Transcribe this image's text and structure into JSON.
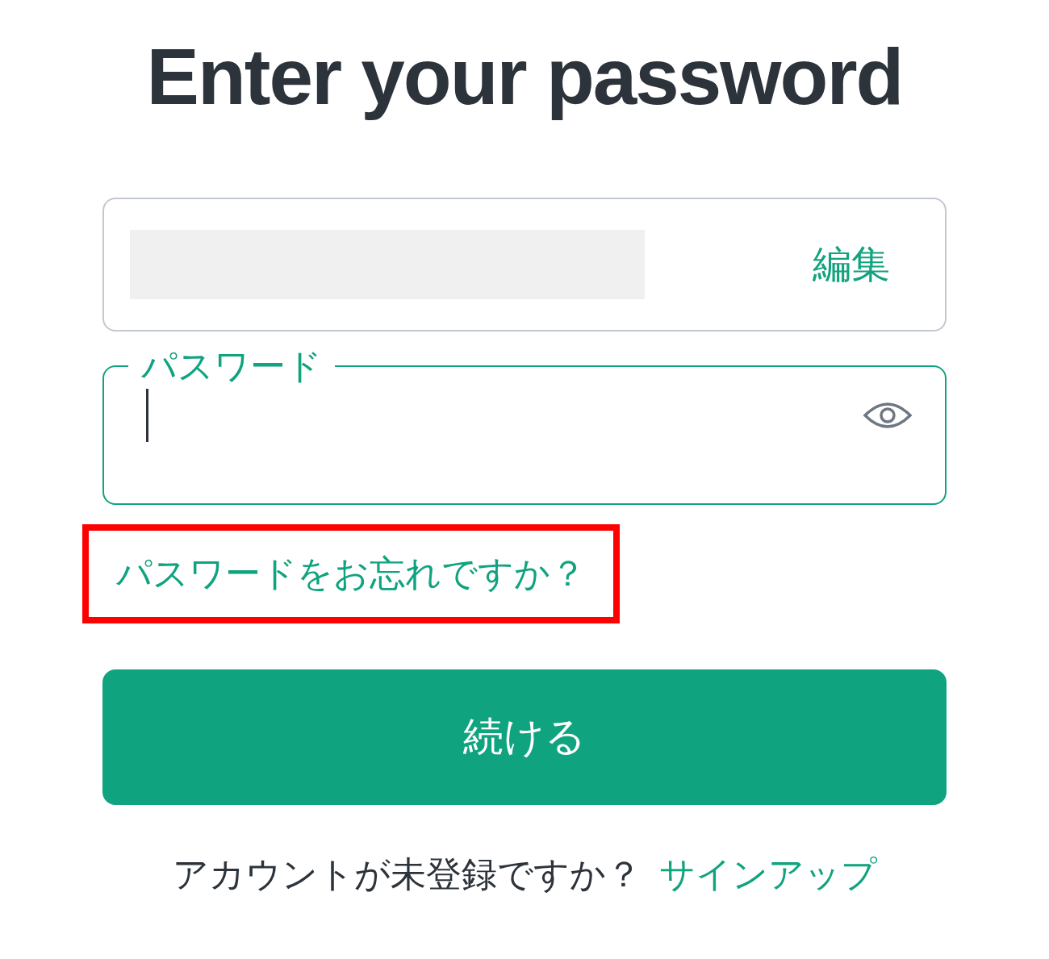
{
  "title": "Enter your password",
  "email_field": {
    "edit_link": "編集"
  },
  "password_field": {
    "label": "パスワード",
    "focused": true
  },
  "forgot_link": {
    "text": "パスワードをお忘れですか？",
    "highlighted": true
  },
  "continue_button": {
    "label": "続ける"
  },
  "signup": {
    "prompt": "アカウントが未登録ですか？",
    "link": "サインアップ"
  }
}
